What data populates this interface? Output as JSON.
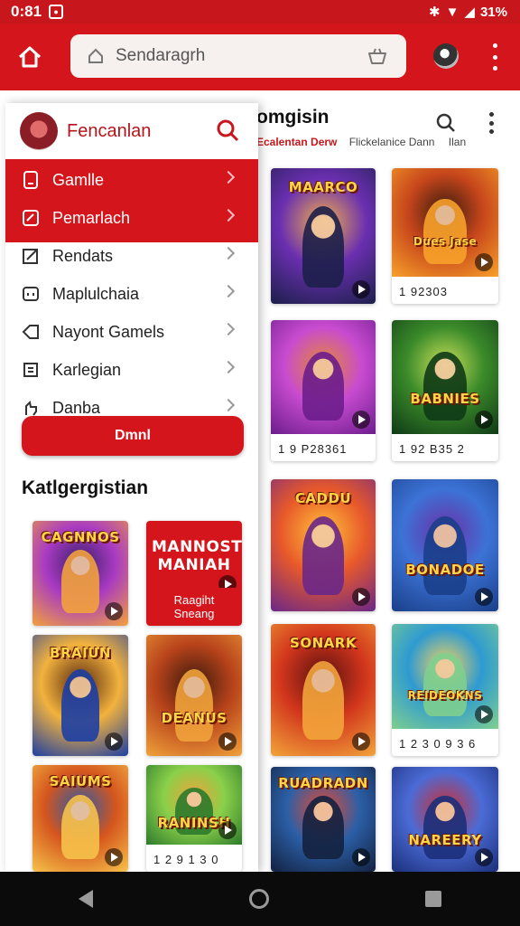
{
  "status_bar": {
    "time": "0:81",
    "battery": "31%"
  },
  "app_bar": {
    "search_placeholder": "Sendaragrh"
  },
  "background": {
    "title": "omgisin",
    "subtitle_tabs": [
      "Ecalentan Derw",
      "Flickelanice Dann",
      "Ilan"
    ],
    "cards": [
      {
        "title": "MAARCO",
        "caption": "",
        "colors": [
          "#1c1f4a",
          "#6a2fb0",
          "#f3b04a"
        ]
      },
      {
        "title": "Dues Jase",
        "caption": "1 92303",
        "colors": [
          "#f7a12a",
          "#c7461b",
          "#3b1b0f"
        ]
      },
      {
        "title": "",
        "caption": "1 9 P28361",
        "colors": [
          "#6c1d8c",
          "#c84bd0",
          "#e28a2f"
        ]
      },
      {
        "title": "BABNIES",
        "caption": "1 92 B35 2",
        "colors": [
          "#0f3a16",
          "#3b8b2a",
          "#c9e05a"
        ]
      },
      {
        "title": "CADDU",
        "caption": "",
        "colors": [
          "#6a2788",
          "#e8592a",
          "#ffc23a"
        ]
      },
      {
        "title": "BONADOE",
        "caption": "",
        "colors": [
          "#1a3f8a",
          "#3c73d6",
          "#6c2ea5"
        ]
      },
      {
        "title": "SONARK",
        "caption": "",
        "colors": [
          "#f2a43a",
          "#d2361c",
          "#5a1010"
        ]
      },
      {
        "title": "REIDEOKNS",
        "caption": "1 2 3 0 9 3 6",
        "colors": [
          "#7fcf8e",
          "#2e9ad1",
          "#f4d35e"
        ]
      },
      {
        "title": "RUADRADN",
        "caption": "",
        "colors": [
          "#13213f",
          "#2b5fa7",
          "#e84a2f"
        ]
      },
      {
        "title": "NAREERY",
        "caption": "",
        "colors": [
          "#1b2f7a",
          "#4b6bd6",
          "#d02e2e"
        ]
      }
    ]
  },
  "drawer": {
    "title": "Fencanlan",
    "menu": [
      {
        "label": "Gamlle",
        "icon": "document-icon",
        "active": true
      },
      {
        "label": "Pemarlach",
        "icon": "edit-icon",
        "active": true
      },
      {
        "label": "Rendats",
        "icon": "pencil-square-icon",
        "active": false
      },
      {
        "label": "Maplulchaia",
        "icon": "message-icon",
        "active": false
      },
      {
        "label": "Nayont Gamels",
        "icon": "tag-icon",
        "active": false
      },
      {
        "label": "Karlegian",
        "icon": "calendar-icon",
        "active": false
      },
      {
        "label": "Danba",
        "icon": "hand-icon",
        "active": false
      }
    ],
    "cta_label": "Dmnl",
    "categories_title": "Katlgergistian",
    "category_tiles": [
      {
        "title": "CAGNNOS",
        "caption": "",
        "colors": [
          "#f2a13d",
          "#a93bc2",
          "#3a1f6b"
        ]
      },
      {
        "title": "MANNOST MANIAH",
        "caption": "Raagiht Sneang",
        "colors": [
          "#d4161c",
          "#d4161c",
          "#d4161c"
        ]
      },
      {
        "title": "BRAIUN",
        "caption": "",
        "colors": [
          "#1c3ea3",
          "#f2b23d",
          "#5a2a10"
        ]
      },
      {
        "title": "DEANUS",
        "caption": "",
        "colors": [
          "#f0a23a",
          "#b8431b",
          "#3b1a0c"
        ]
      },
      {
        "title": "SAIUMS",
        "caption": "",
        "colors": [
          "#f7c24a",
          "#d5561d",
          "#2a5aa8"
        ]
      },
      {
        "title": "RANINSH",
        "caption": "1 2 9 1 3 0",
        "colors": [
          "#2d7a2c",
          "#8ad04a",
          "#f0a23a"
        ]
      }
    ]
  }
}
